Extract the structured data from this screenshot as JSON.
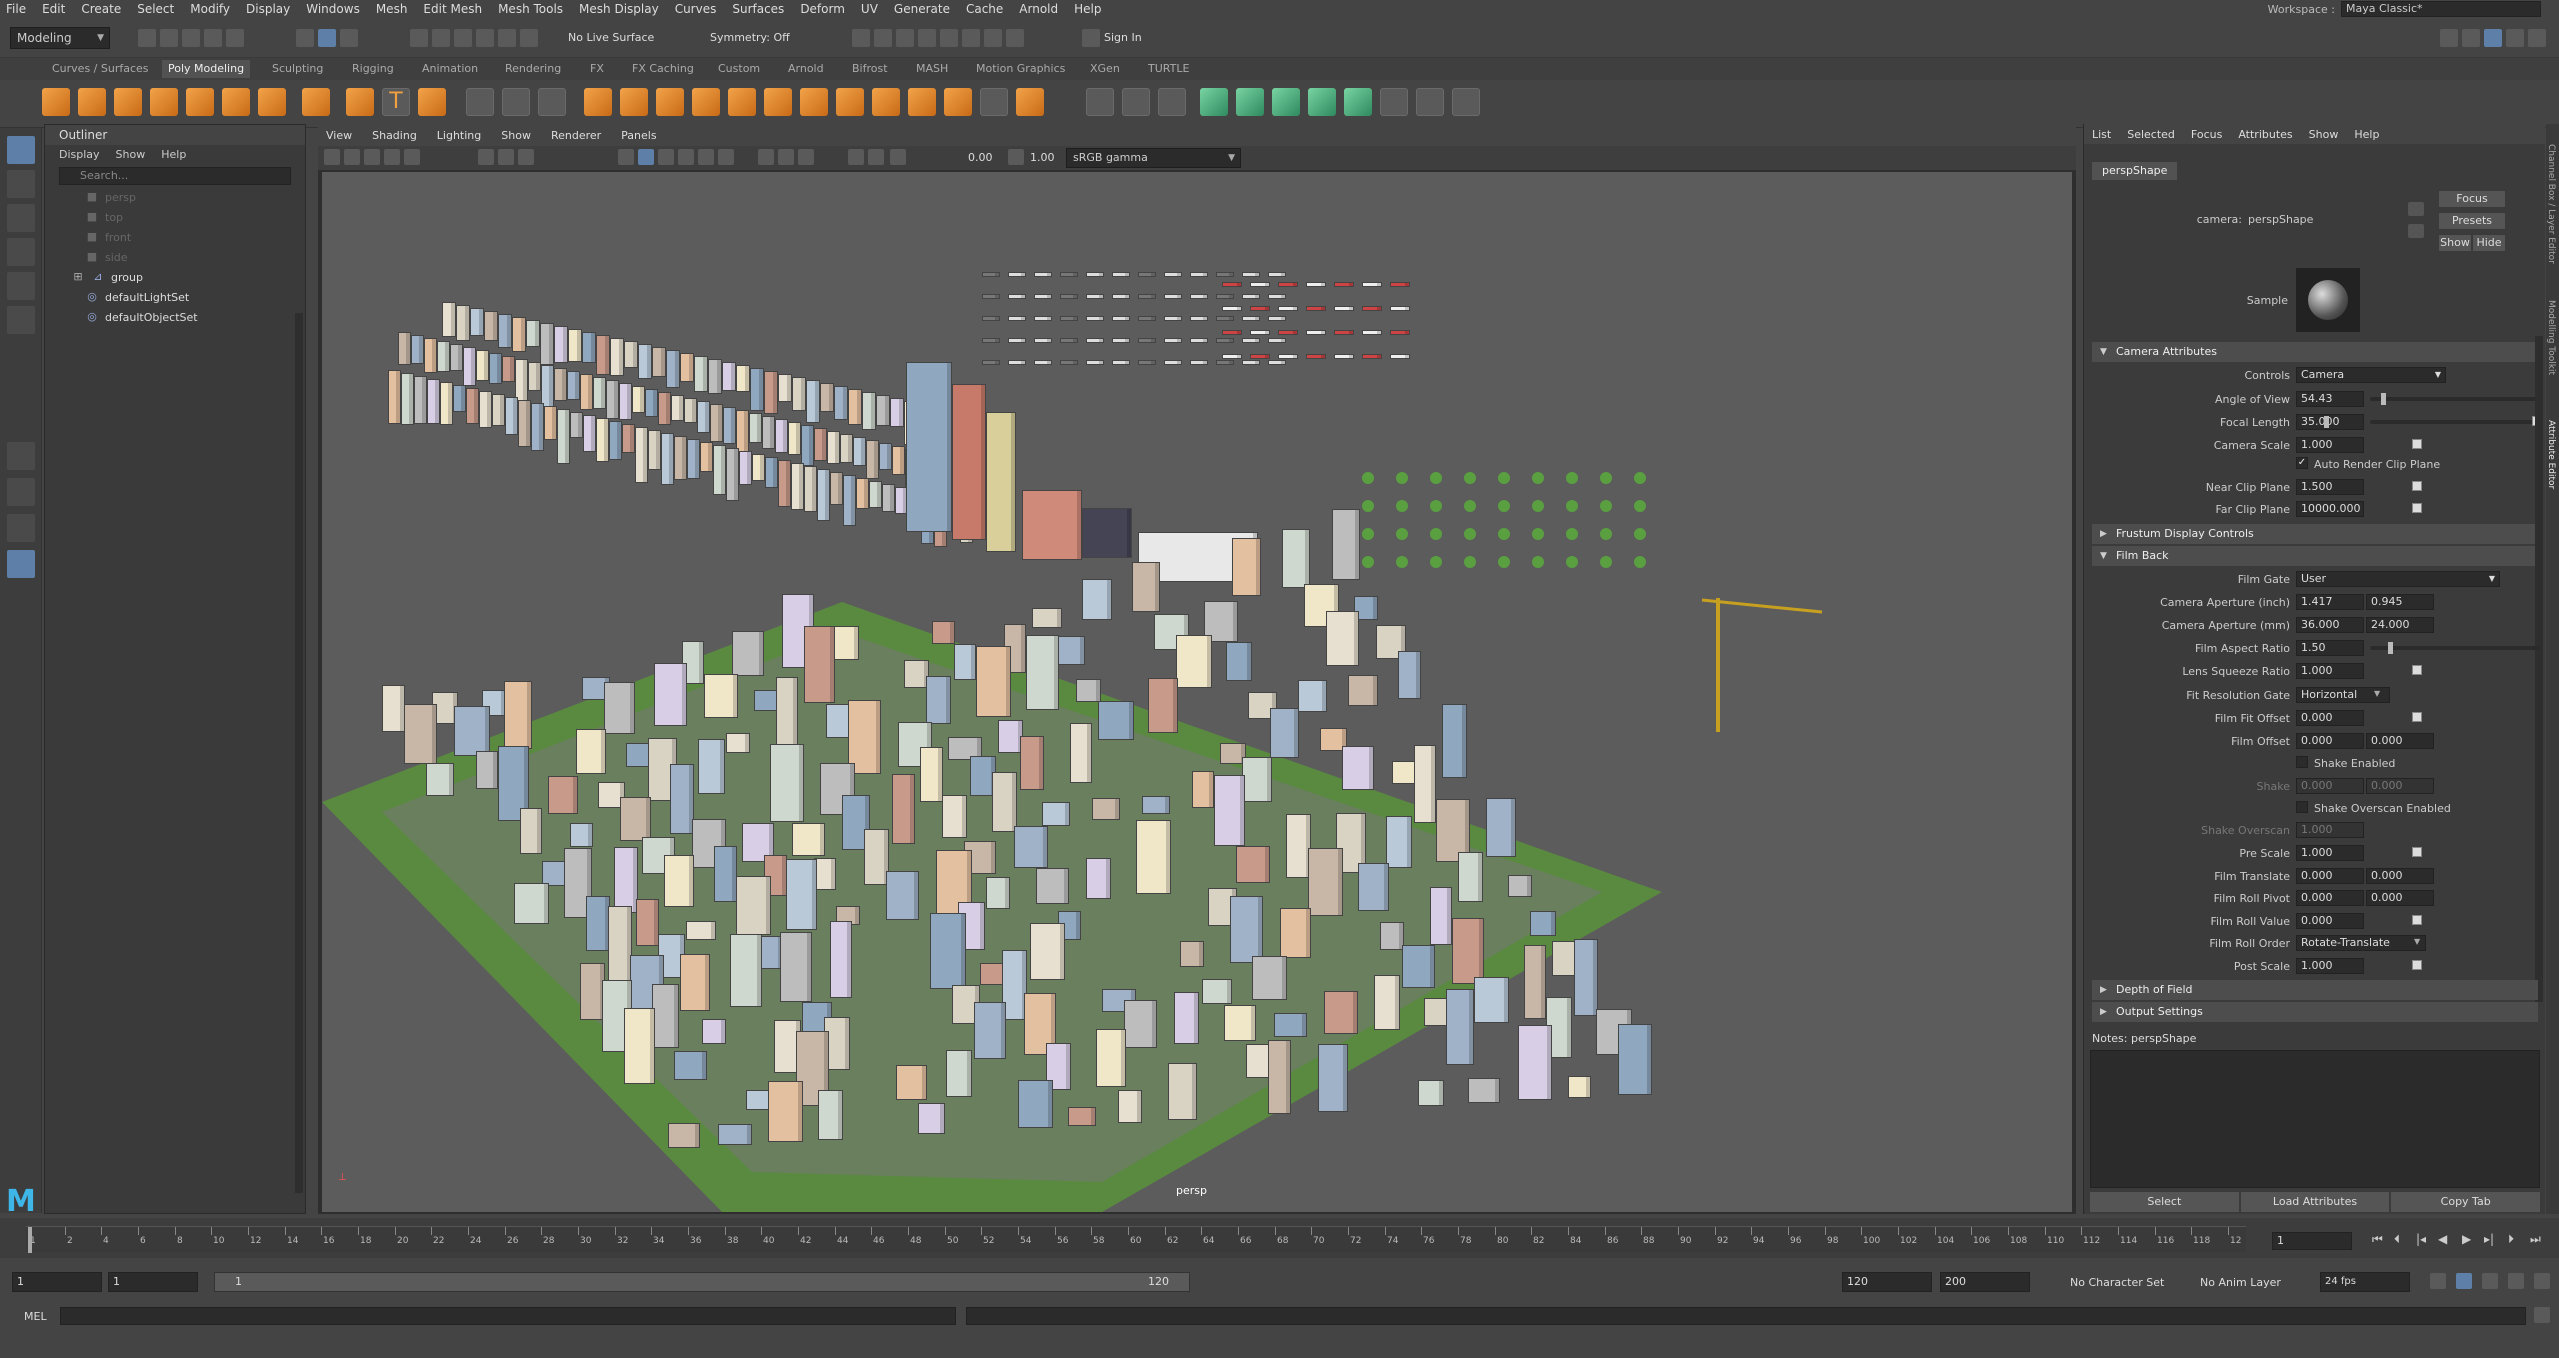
{
  "menubar": {
    "items": [
      "File",
      "Edit",
      "Create",
      "Select",
      "Modify",
      "Display",
      "Windows",
      "Mesh",
      "Edit Mesh",
      "Mesh Tools",
      "Mesh Display",
      "Curves",
      "Surfaces",
      "Deform",
      "UV",
      "Generate",
      "Cache",
      "Arnold",
      "Help"
    ],
    "workspace_label": "Workspace :",
    "workspace_value": "Maya Classic*"
  },
  "statusline": {
    "menuset": "Modeling",
    "live_surface": "No Live Surface",
    "symmetry": "Symmetry: Off",
    "sign_in": "Sign In"
  },
  "shelf": {
    "tabs": [
      "Curves / Surfaces",
      "Poly Modeling",
      "Sculpting",
      "Rigging",
      "Animation",
      "Rendering",
      "FX",
      "FX Caching",
      "Custom",
      "Arnold",
      "Bifrost",
      "MASH",
      "Motion Graphics",
      "XGen",
      "TURTLE"
    ],
    "active_tab": "Poly Modeling",
    "text_icon": "T"
  },
  "outliner": {
    "title": "Outliner",
    "menu": [
      "Display",
      "Show",
      "Help"
    ],
    "search_placeholder": "Search...",
    "items": [
      {
        "label": "persp",
        "icon": "camera-icon",
        "dim": true
      },
      {
        "label": "top",
        "icon": "camera-icon",
        "dim": true
      },
      {
        "label": "front",
        "icon": "camera-icon",
        "dim": true
      },
      {
        "label": "side",
        "icon": "camera-icon",
        "dim": true
      },
      {
        "label": "group",
        "icon": "group-icon",
        "dim": false
      },
      {
        "label": "defaultLightSet",
        "icon": "set-icon",
        "dim": false
      },
      {
        "label": "defaultObjectSet",
        "icon": "set-icon",
        "dim": false
      }
    ]
  },
  "viewport": {
    "menu": [
      "View",
      "Shading",
      "Lighting",
      "Show",
      "Renderer",
      "Panels"
    ],
    "exposure": "0.00",
    "gamma": "1.00",
    "colorspace": "sRGB gamma",
    "camera_label": "persp"
  },
  "attribute_editor": {
    "menu": [
      "List",
      "Selected",
      "Focus",
      "Attributes",
      "Show",
      "Help"
    ],
    "tab": "perspShape",
    "camera_label": "camera:",
    "camera_value": "perspShape",
    "buttons": {
      "focus": "Focus",
      "presets": "Presets",
      "show": "Show",
      "hide": "Hide"
    },
    "sample_label": "Sample",
    "sections": {
      "camera_attributes": "Camera Attributes",
      "frustum": "Frustum Display Controls",
      "film_back": "Film Back",
      "dof": "Depth of Field",
      "output": "Output Settings"
    },
    "fields": {
      "controls": {
        "label": "Controls",
        "value": "Camera"
      },
      "angle_of_view": {
        "label": "Angle of View",
        "value": "54.43"
      },
      "focal_length": {
        "label": "Focal Length",
        "value": "35.000"
      },
      "camera_scale": {
        "label": "Camera Scale",
        "value": "1.000"
      },
      "auto_render_clip": {
        "label": "Auto Render Clip Plane"
      },
      "near_clip": {
        "label": "Near Clip Plane",
        "value": "1.500"
      },
      "far_clip": {
        "label": "Far Clip Plane",
        "value": "10000.000"
      },
      "film_gate": {
        "label": "Film Gate",
        "value": "User"
      },
      "aperture_inch": {
        "label": "Camera Aperture (inch)",
        "v1": "1.417",
        "v2": "0.945"
      },
      "aperture_mm": {
        "label": "Camera Aperture (mm)",
        "v1": "36.000",
        "v2": "24.000"
      },
      "aspect_ratio": {
        "label": "Film Aspect Ratio",
        "value": "1.50"
      },
      "lens_squeeze": {
        "label": "Lens Squeeze Ratio",
        "value": "1.000"
      },
      "fit_gate": {
        "label": "Fit Resolution Gate",
        "value": "Horizontal"
      },
      "film_fit_offset": {
        "label": "Film Fit Offset",
        "value": "0.000"
      },
      "film_offset": {
        "label": "Film Offset",
        "v1": "0.000",
        "v2": "0.000"
      },
      "shake_enabled": {
        "label": "Shake Enabled"
      },
      "shake": {
        "label": "Shake",
        "v1": "0.000",
        "v2": "0.000"
      },
      "shake_overscan_enabled": {
        "label": "Shake Overscan Enabled"
      },
      "shake_overscan": {
        "label": "Shake Overscan",
        "value": "1.000"
      },
      "pre_scale": {
        "label": "Pre Scale",
        "value": "1.000"
      },
      "film_translate": {
        "label": "Film Translate",
        "v1": "0.000",
        "v2": "0.000"
      },
      "film_roll_pivot": {
        "label": "Film Roll Pivot",
        "v1": "0.000",
        "v2": "0.000"
      },
      "film_roll_value": {
        "label": "Film Roll Value",
        "value": "0.000"
      },
      "film_roll_order": {
        "label": "Film Roll Order",
        "value": "Rotate-Translate"
      },
      "post_scale": {
        "label": "Post Scale",
        "value": "1.000"
      }
    },
    "notes_label": "Notes:  perspShape",
    "bottom_buttons": {
      "select": "Select",
      "load": "Load Attributes",
      "copy": "Copy Tab"
    }
  },
  "side_tabs": [
    "Channel Box / Layer Editor",
    "Modelling Toolkit",
    "Attribute Editor"
  ],
  "timeslider": {
    "ticks": [
      "1",
      "2",
      "4",
      "6",
      "8",
      "10",
      "12",
      "14",
      "16",
      "18",
      "20",
      "22",
      "24",
      "26",
      "28",
      "30",
      "32",
      "34",
      "36",
      "38",
      "40",
      "42",
      "44",
      "46",
      "48",
      "50",
      "52",
      "54",
      "56",
      "58",
      "60",
      "62",
      "64",
      "66",
      "68",
      "70",
      "72",
      "74",
      "76",
      "78",
      "80",
      "82",
      "84",
      "86",
      "88",
      "90",
      "92",
      "94",
      "96",
      "98",
      "100",
      "102",
      "104",
      "106",
      "108",
      "110",
      "112",
      "114",
      "116",
      "118",
      "12"
    ],
    "current_frame": "1"
  },
  "rangeslider": {
    "start": "1",
    "range_start": "1",
    "slider_start": "1",
    "slider_end": "120",
    "range_end": "120",
    "end": "200",
    "character_set": "No Character Set",
    "anim_layer": "No Anim Layer",
    "fps": "24 fps"
  },
  "cmdline": {
    "label": "MEL"
  }
}
